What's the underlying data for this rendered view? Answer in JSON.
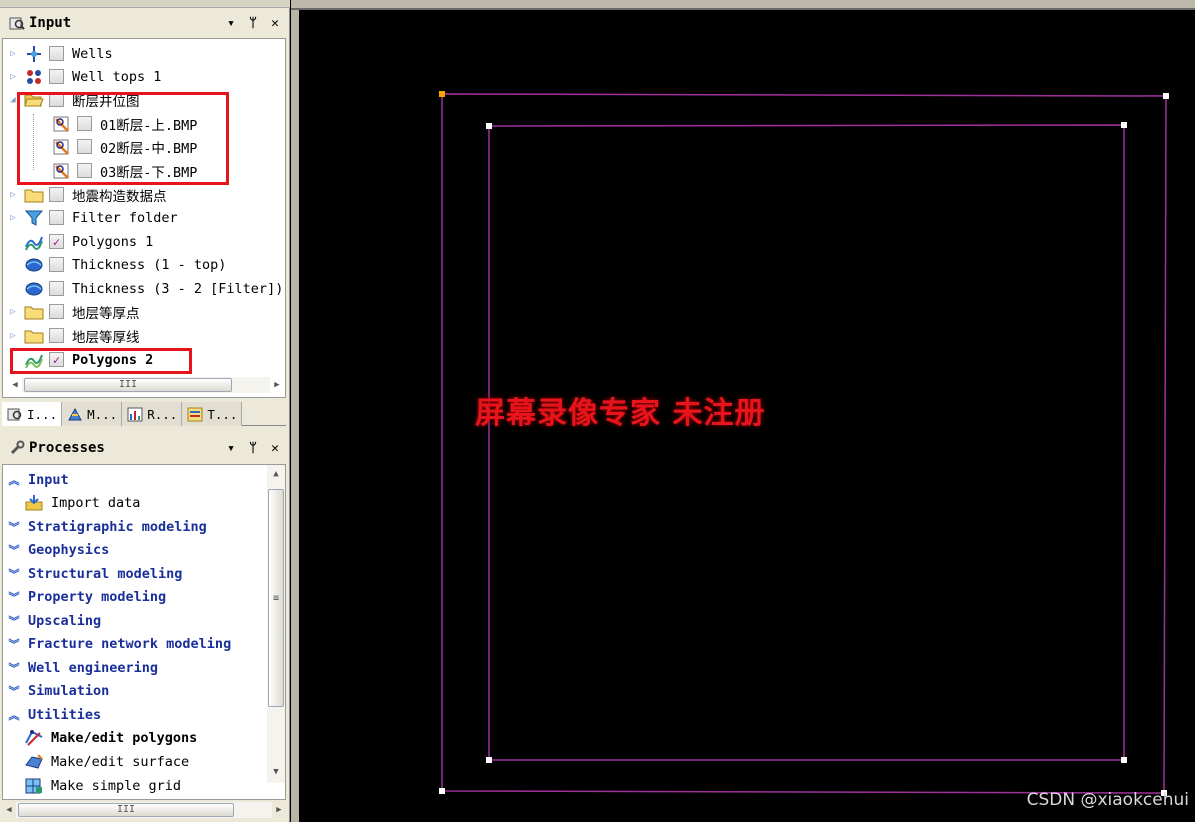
{
  "input_panel": {
    "title": "Input",
    "pin_glyph": "↓",
    "close_glyph": "✕",
    "items": [
      {
        "label": "Wells",
        "icon": "wells-icon",
        "checked": false
      },
      {
        "label": "Well tops 1",
        "icon": "well-tops-icon",
        "checked": false
      },
      {
        "label": "断层井位图",
        "icon": "folder-open-icon",
        "checked": false
      },
      {
        "label": "01断层-上.BMP",
        "icon": "bitmap-icon",
        "checked": false
      },
      {
        "label": "02断层-中.BMP",
        "icon": "bitmap-icon",
        "checked": false
      },
      {
        "label": "03断层-下.BMP",
        "icon": "bitmap-icon",
        "checked": false
      },
      {
        "label": "地震构造数据点",
        "icon": "folder-icon",
        "checked": false
      },
      {
        "label": "Filter folder",
        "icon": "filter-folder-icon",
        "checked": false
      },
      {
        "label": "Polygons 1",
        "icon": "polygons-icon",
        "checked": true
      },
      {
        "label": "Thickness (1 - top)",
        "icon": "thickness-icon",
        "checked": false
      },
      {
        "label": "Thickness (3 - 2 [Filter])",
        "icon": "thickness-icon",
        "checked": false
      },
      {
        "label": "地层等厚点",
        "icon": "folder-icon",
        "checked": false
      },
      {
        "label": "地层等厚线",
        "icon": "folder-icon",
        "checked": false
      },
      {
        "label": "Polygons 2",
        "icon": "polygons-icon",
        "checked": true
      }
    ],
    "scroll_grip": "III"
  },
  "tabs": [
    {
      "label": "I...",
      "icon": "input-tab-icon"
    },
    {
      "label": "M...",
      "icon": "models-tab-icon"
    },
    {
      "label": "R...",
      "icon": "results-tab-icon"
    },
    {
      "label": "T...",
      "icon": "templates-tab-icon"
    }
  ],
  "processes_panel": {
    "title": "Processes",
    "pin_glyph": "↓",
    "close_glyph": "✕",
    "items": [
      {
        "label": "Input",
        "kind": "category",
        "expanded": true
      },
      {
        "label": "Import data",
        "kind": "item",
        "icon": "import-data-icon"
      },
      {
        "label": "Stratigraphic modeling",
        "kind": "category",
        "expanded": false
      },
      {
        "label": "Geophysics",
        "kind": "category",
        "expanded": false
      },
      {
        "label": "Structural modeling",
        "kind": "category",
        "expanded": false
      },
      {
        "label": "Property modeling",
        "kind": "category",
        "expanded": false
      },
      {
        "label": "Upscaling",
        "kind": "category",
        "expanded": false
      },
      {
        "label": "Fracture network modeling",
        "kind": "category",
        "expanded": false
      },
      {
        "label": "Well engineering",
        "kind": "category",
        "expanded": false
      },
      {
        "label": "Simulation",
        "kind": "category",
        "expanded": false
      },
      {
        "label": "Utilities",
        "kind": "category",
        "expanded": true
      },
      {
        "label": "Make/edit polygons",
        "kind": "item",
        "icon": "make-edit-polygons-icon",
        "bold": true
      },
      {
        "label": "Make/edit surface",
        "kind": "item",
        "icon": "make-edit-surface-icon"
      },
      {
        "label": "Make simple grid",
        "kind": "item",
        "icon": "make-simple-grid-icon"
      }
    ],
    "scroll_grip": "III",
    "vscroll_grip": "≡"
  },
  "viewport": {
    "watermark": "屏幕录像专家  未注册",
    "credit": "CSDN @xiaokcehui",
    "polygon_color": "#a0309c",
    "node_color": "#ffffff",
    "start_node_color": "#ffa500"
  },
  "colors": {
    "highlight_box": "#e8141c",
    "category_text": "#1a2f9a",
    "check_mark": "#a01080"
  }
}
